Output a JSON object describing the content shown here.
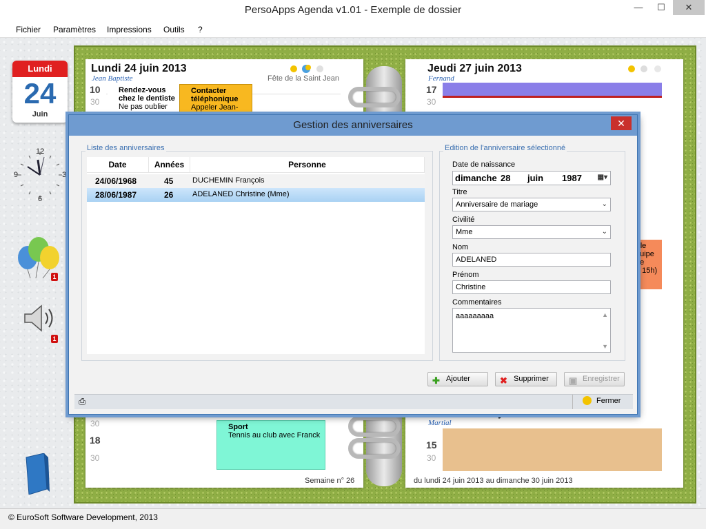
{
  "window": {
    "title": "PersoApps Agenda v1.01 - Exemple de dossier",
    "min": "—",
    "max": "☐",
    "close": "✕"
  },
  "menu": [
    "Fichier",
    "Paramètres",
    "Impressions",
    "Outils",
    "?"
  ],
  "widgets": {
    "calendar": {
      "day": "Lundi",
      "date": "24",
      "month": "Juin"
    },
    "clock": {
      "n12": "12",
      "n3": "3",
      "n6": "6",
      "n9": "9"
    },
    "birthday_badge": "1",
    "sound_badge": "1"
  },
  "left_page": {
    "title": "Lundi 24 juin 2013",
    "saint": "Jean Baptiste",
    "fete": "Fête de la Saint Jean",
    "hours": [
      "10",
      "30",
      "18",
      "30"
    ],
    "events": [
      {
        "title": "Rendez-vous chez le dentiste",
        "text": "Ne pas oublier de"
      },
      {
        "title": "Contacter téléphonique",
        "text": "Appeler Jean-",
        "color": "#f8b820"
      },
      {
        "title": "Sport",
        "text": "Tennis au club avec Franck",
        "color": "#7ff6d6"
      }
    ],
    "footer": "Semaine n° 26"
  },
  "right_page": {
    "title": "Jeudi 27 juin 2013",
    "saint": "Fernand",
    "hours": [
      "17",
      "30",
      "15",
      "30"
    ],
    "bottom_title": "Dimanche 30 juin 2013",
    "bottom_saint": "Martial",
    "partial_event": "r le\nquipe\nde\ne 15h)",
    "footer": "du lundi 24 juin 2013 au dimanche 30 juin 2013"
  },
  "dialog": {
    "title": "Gestion des anniversaires",
    "close": "✕",
    "list_group": "Liste des anniversaires",
    "edit_group": "Edition de l'anniversaire sélectionné",
    "columns": [
      "Date",
      "Années",
      "Personne"
    ],
    "rows": [
      {
        "date": "24/06/1968",
        "years": "45",
        "person": "DUCHEMIN François"
      },
      {
        "date": "28/06/1987",
        "years": "26",
        "person": "ADELANED Christine (Mme)"
      }
    ],
    "selected_row": 1,
    "form": {
      "birth_label": "Date de naissance",
      "birth_day": "dimanche",
      "birth_num": "28",
      "birth_month": "juin",
      "birth_year": "1987",
      "title_label": "Titre",
      "title_value": "Anniversaire de mariage",
      "civ_label": "Civilité",
      "civ_value": "Mme",
      "nom_label": "Nom",
      "nom_value": "ADELANED",
      "prenom_label": "Prénom",
      "prenom_value": "Christine",
      "comment_label": "Commentaires",
      "comment_value": "aaaaaaaaa"
    },
    "buttons": {
      "add": "Ajouter",
      "delete": "Supprimer",
      "save": "Enregistrer",
      "close": "Fermer"
    }
  },
  "status": "© EuroSoft Software Development, 2013",
  "colors": {
    "accent": "#6f9bd0",
    "selected_row": "#b9d9f6",
    "grass": "#8fae45",
    "danger": "#d01010"
  }
}
